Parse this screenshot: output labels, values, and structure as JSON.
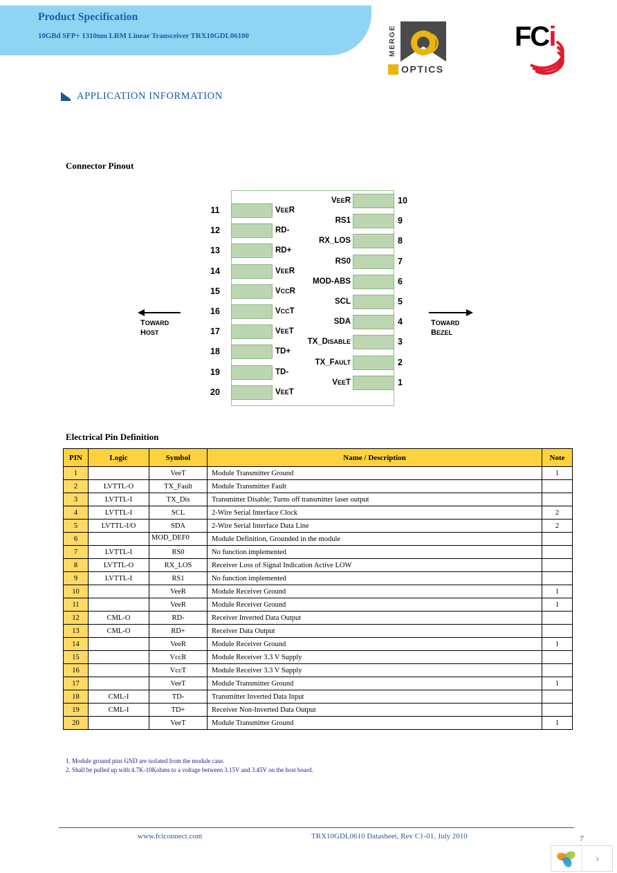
{
  "header": {
    "title": "Product Specification",
    "subtitle": "10GBd SFP+ 1310nm LRM Linear Transceiver TRX10GDL06100",
    "band_color": "#8fd4f2",
    "title_color": "#1a5fa8"
  },
  "logos": {
    "merge": {
      "word_vertical": "MERGE",
      "word_horizontal": "OPTICS",
      "accent_color": "#e8b511",
      "dark_color": "#4a4a4a"
    },
    "fci": {
      "text": "FCi",
      "accent_color": "#e01b2e"
    }
  },
  "section": {
    "heading": "APPLICATION INFORMATION",
    "heading_color": "#15599e"
  },
  "pinout": {
    "heading": "Connector Pinout",
    "toward_host": {
      "line1": "T",
      "line1b": "OWARD",
      "line2": "H",
      "line2b": "OST"
    },
    "toward_bezel": {
      "line1": "T",
      "line1b": "OWARD",
      "line2": "B",
      "line2b": "EZEL"
    },
    "pad_color": "#bcd6b2",
    "pad_border": "#8fb383",
    "left_pins": [
      {
        "num": "11",
        "label": "V",
        "label_sm": "EE",
        "label_end": "R"
      },
      {
        "num": "12",
        "label": "RD-",
        "label_sm": "",
        "label_end": ""
      },
      {
        "num": "13",
        "label": "RD+",
        "label_sm": "",
        "label_end": ""
      },
      {
        "num": "14",
        "label": "V",
        "label_sm": "EE",
        "label_end": "R"
      },
      {
        "num": "15",
        "label": "V",
        "label_sm": "CC",
        "label_end": "R"
      },
      {
        "num": "16",
        "label": "V",
        "label_sm": "CC",
        "label_end": "T"
      },
      {
        "num": "17",
        "label": "V",
        "label_sm": "EE",
        "label_end": "T"
      },
      {
        "num": "18",
        "label": "TD+",
        "label_sm": "",
        "label_end": ""
      },
      {
        "num": "19",
        "label": "TD-",
        "label_sm": "",
        "label_end": ""
      },
      {
        "num": "20",
        "label": "V",
        "label_sm": "EE",
        "label_end": "T"
      }
    ],
    "right_pins": [
      {
        "num": "10",
        "label": "V",
        "label_sm": "EE",
        "label_end": "R"
      },
      {
        "num": "9",
        "label": "RS1",
        "label_sm": "",
        "label_end": ""
      },
      {
        "num": "8",
        "label": "RX_LOS",
        "label_sm": "",
        "label_end": ""
      },
      {
        "num": "7",
        "label": "RS0",
        "label_sm": "",
        "label_end": ""
      },
      {
        "num": "6",
        "label": "MOD-ABS",
        "label_sm": "",
        "label_end": ""
      },
      {
        "num": "5",
        "label": "SCL",
        "label_sm": "",
        "label_end": ""
      },
      {
        "num": "4",
        "label": "SDA",
        "label_sm": "",
        "label_end": ""
      },
      {
        "num": "3",
        "label": "TX_D",
        "label_sm": "ISABLE",
        "label_end": ""
      },
      {
        "num": "2",
        "label": "TX_F",
        "label_sm": "AULT",
        "label_end": ""
      },
      {
        "num": "1",
        "label": "V",
        "label_sm": "EE",
        "label_end": "T"
      }
    ]
  },
  "table": {
    "heading": "Electrical Pin Definition",
    "header_color": "#ffd23d",
    "pin_cell_color": "#ffd966",
    "columns": [
      "PIN",
      "Logic",
      "Symbol",
      "Name / Description",
      "Note"
    ],
    "rows": [
      {
        "pin": "1",
        "logic": "",
        "symbol": "VeeT",
        "desc": "Module Transmitter Ground",
        "note": "1"
      },
      {
        "pin": "2",
        "logic": "LVTTL-O",
        "symbol": "TX_Fault",
        "desc": "Module Transmitter Fault",
        "note": ""
      },
      {
        "pin": "3",
        "logic": "LVTTL-I",
        "symbol": "TX_Dis",
        "desc": "Transmitter Disable; Turns off transmitter laser output",
        "note": ""
      },
      {
        "pin": "4",
        "logic": "LVTTL-I",
        "symbol": "SCL",
        "desc": "2-Wire Serial Interface Clock",
        "note": "2"
      },
      {
        "pin": "5",
        "logic": "LVTTL-I/O",
        "symbol": "SDA",
        "desc": "2-Wire Serial Interface Data Line",
        "note": "2"
      },
      {
        "pin": "6",
        "logic": "",
        "symbol": "MOD_DEF0",
        "desc": "Module Definition, Grounded in the module",
        "note": "",
        "symbol_overflows": true
      },
      {
        "pin": "7",
        "logic": "LVTTL-I",
        "symbol": "RS0",
        "desc": "No function implemented",
        "note": ""
      },
      {
        "pin": "8",
        "logic": "LVTTL-O",
        "symbol": "RX_LOS",
        "desc": "Receiver Loss of Signal Indication Active LOW",
        "note": ""
      },
      {
        "pin": "9",
        "logic": "LVTTL-I",
        "symbol": "RS1",
        "desc": "No function implemented",
        "note": ""
      },
      {
        "pin": "10",
        "logic": "",
        "symbol": "VeeR",
        "desc": "Module Receiver Ground",
        "note": "1"
      },
      {
        "pin": "11",
        "logic": "",
        "symbol": "VeeR",
        "desc": "Module Receiver Ground",
        "note": "1"
      },
      {
        "pin": "12",
        "logic": "CML-O",
        "symbol": "RD-",
        "desc": "Receiver Inverted Data Output",
        "note": ""
      },
      {
        "pin": "13",
        "logic": "CML-O",
        "symbol": "RD+",
        "desc": "Receiver Data Output",
        "note": ""
      },
      {
        "pin": "14",
        "logic": "",
        "symbol": "VeeR",
        "desc": "Module Receiver Ground",
        "note": "1"
      },
      {
        "pin": "15",
        "logic": "",
        "symbol": "VccR",
        "desc": "Module Receiver 3.3 V Supply",
        "note": ""
      },
      {
        "pin": "16",
        "logic": "",
        "symbol": "VccT",
        "desc": "Module Receiver 3.3 V Supply",
        "note": ""
      },
      {
        "pin": "17",
        "logic": "",
        "symbol": "VeeT",
        "desc": "Module Transmitter Ground",
        "note": "1"
      },
      {
        "pin": "18",
        "logic": "CML-I",
        "symbol": "TD-",
        "desc": "Transmitter Inverted Data Input",
        "note": ""
      },
      {
        "pin": "19",
        "logic": "CML-I",
        "symbol": "TD+",
        "desc": "Receiver Non-Inverted Data Output",
        "note": ""
      },
      {
        "pin": "20",
        "logic": "",
        "symbol": "VeeT",
        "desc": "Module Transmitter Ground",
        "note": "1"
      }
    ]
  },
  "notes": {
    "note1": "1. Module ground pins GND are isolated from the module case.",
    "note2": "2. Shall be pulled up with 4.7K-10Kohms to a voltage between 3.15V and 3.45V on the host board."
  },
  "footer": {
    "left": "www.fciconnect.com",
    "center": "TRX10GDL0610 Datasheet, Rev C1-01, July 2010",
    "page_number": "7",
    "color": "#2a5699"
  },
  "widget": {
    "next_label": "›"
  }
}
